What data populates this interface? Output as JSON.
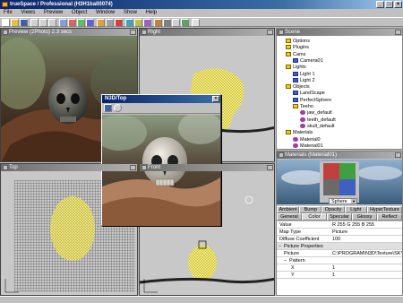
{
  "app": {
    "title": "trueSpace / Professional (H3H1ball0074)"
  },
  "window_controls": [
    "_",
    "□",
    "×"
  ],
  "menu": [
    "File",
    "Views",
    "Preview",
    "Object",
    "Window",
    "Show",
    "Help"
  ],
  "viewports": {
    "preview": {
      "title": "Preview (2Photo) 2.3 secs"
    },
    "right": {
      "title": "Right"
    },
    "top": {
      "title": "Top"
    },
    "front": {
      "title": "Front"
    }
  },
  "float_window": {
    "title": "N3D/Top"
  },
  "scene_tree": {
    "title": "Scene",
    "items": [
      {
        "label": "Options",
        "kind": "folder",
        "level": 0
      },
      {
        "label": "Plugins",
        "kind": "folder",
        "level": 0
      },
      {
        "label": "Cams",
        "kind": "folder",
        "level": 0
      },
      {
        "label": "Camera01",
        "kind": "obj",
        "level": 1
      },
      {
        "label": "Lights",
        "kind": "folder",
        "level": 0
      },
      {
        "label": "Light 1",
        "kind": "obj",
        "level": 1
      },
      {
        "label": "Light 2",
        "kind": "obj",
        "level": 1
      },
      {
        "label": "Objects",
        "kind": "folder",
        "level": 0
      },
      {
        "label": "LandScape",
        "kind": "obj",
        "level": 1
      },
      {
        "label": "PerfectSphere",
        "kind": "obj",
        "level": 1
      },
      {
        "label": "Teeho",
        "kind": "folder",
        "level": 1
      },
      {
        "label": "jaw_default",
        "kind": "mat",
        "level": 2
      },
      {
        "label": "teeth_default",
        "kind": "mat",
        "level": 2
      },
      {
        "label": "skull_default",
        "kind": "mat",
        "level": 2
      },
      {
        "label": "Materials",
        "kind": "folder",
        "level": 0
      },
      {
        "label": "Material0",
        "kind": "mat",
        "level": 1
      },
      {
        "label": "Material01",
        "kind": "mat",
        "level": 1
      }
    ]
  },
  "materials": {
    "title": "Materials (Material01)",
    "shape_select": "Sphere",
    "tabs_row1": [
      "Ambient",
      "Bump",
      "Opacity",
      "Light",
      "HyperTexture"
    ],
    "tabs_row2": [
      "General",
      "Color",
      "Specular",
      "Glossy",
      "Reflect"
    ],
    "props": [
      {
        "k": "Value",
        "v": "R 255 G 255 B 255"
      },
      {
        "k": "Map Type",
        "v": "Picture"
      },
      {
        "k": "Diffuse Coefficient",
        "v": "100"
      }
    ],
    "section": "Picture Properties",
    "picture": {
      "k": "Picture",
      "v": "C:\\PROGRAM\\N3D\\Texture\\SKY"
    },
    "pattern": "Pattern",
    "pattern_rows": [
      {
        "k": "X",
        "v": "1"
      },
      {
        "k": "Y",
        "v": "1"
      }
    ]
  }
}
